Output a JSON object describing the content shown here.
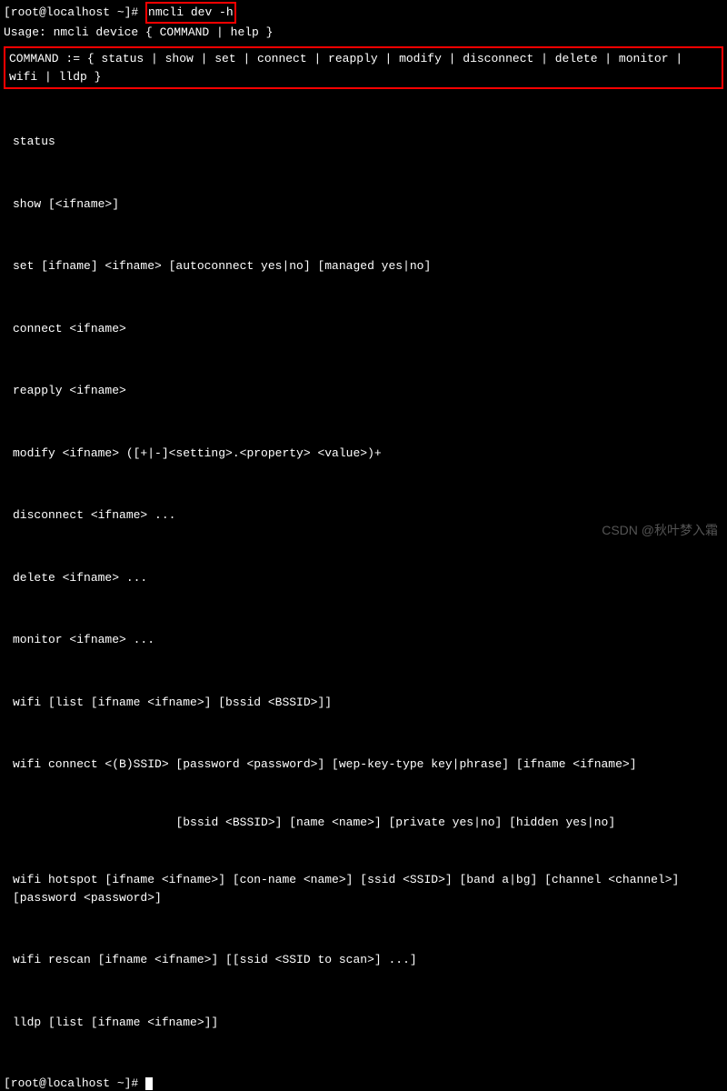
{
  "prompt1_prefix": "[root@localhost ~]# ",
  "typed_command": "nmcli dev -h",
  "usage_line": "Usage: nmcli device { COMMAND | help }",
  "command_box_text": "COMMAND := { status | show | set | connect | reapply | modify | disconnect | delete | monitor | wifi | lldp }",
  "cmds": {
    "c0": "status",
    "c1": "show [<ifname>]",
    "c2": "set [ifname] <ifname> [autoconnect yes|no] [managed yes|no]",
    "c3": "connect <ifname>",
    "c4": "reapply <ifname>",
    "c5": "modify <ifname> ([+|-]<setting>.<property> <value>)+",
    "c6": "disconnect <ifname> ...",
    "c7": "delete <ifname> ...",
    "c8": "monitor <ifname> ...",
    "c9": "wifi [list [ifname <ifname>] [bssid <BSSID>]]",
    "c10a": "wifi connect <(B)SSID> [password <password>] [wep-key-type key|phrase] [ifname <ifname>]",
    "c10b": "                       [bssid <BSSID>] [name <name>] [private yes|no] [hidden yes|no]",
    "c11": "wifi hotspot [ifname <ifname>] [con-name <name>] [ssid <SSID>] [band a|bg] [channel <channel>] [password <password>]",
    "c12": "wifi rescan [ifname <ifname>] [[ssid <SSID to scan>] ...]",
    "c13": "lldp [list [ifname <ifname>]]"
  },
  "prompt2": "[root@localhost ~]# ",
  "watermark": "CSDN @秋叶梦入霜"
}
